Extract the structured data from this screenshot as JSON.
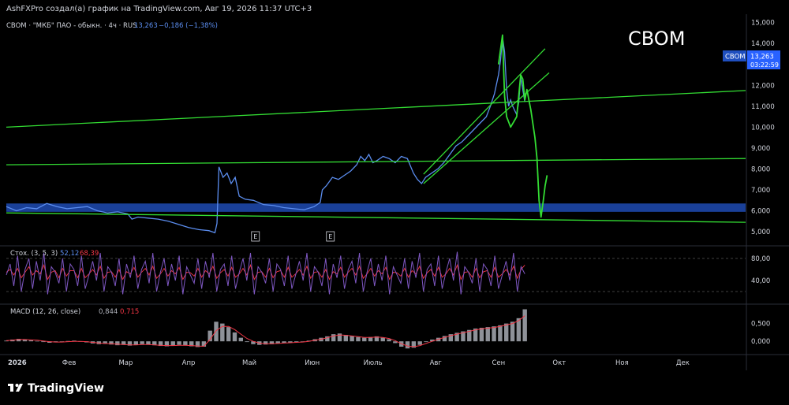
{
  "header": {
    "attribution": "AshFXPro создал(а) график на TradingView.com, Авг 19, 2026 11:37 UTC+3",
    "symbol_line": "CBOM · \"МКБ\" ПАО - обыкн. · 4ч · RUS",
    "last": "13,263",
    "change": "−0,186 (−1,38%)"
  },
  "watermark": "CBOM",
  "price_badge": {
    "ticker": "CBOM",
    "price": "13,263",
    "countdown": "03:22:59"
  },
  "footer": {
    "brand": "TradingView"
  },
  "colors": {
    "background": "#000000",
    "price_line": "#5b8def",
    "drawing_green": "#33dd33",
    "support_zone": "#1e4bb3",
    "stoch_k": "#7e57c2",
    "stoch_d": "#f23645",
    "macd_hist": "#b2b5be",
    "macd_signal": "#f23645",
    "text": "#d1d4dc",
    "blue_text": "#5b8def",
    "red_text": "#f23645"
  },
  "chart_data": [
    {
      "type": "line",
      "name": "price",
      "x_ticks": [
        "2026",
        "Фев",
        "Мар",
        "Апр",
        "Май",
        "Июн",
        "Июль",
        "Авг",
        "Сен",
        "Окт",
        "Ноя",
        "Дек"
      ],
      "y_ticks": [
        "5,000",
        "6,000",
        "7,000",
        "8,000",
        "9,000",
        "10,000",
        "11,000",
        "12,000",
        "13,000",
        "14,000",
        "15,000"
      ],
      "ylim": [
        4.4,
        15.4
      ],
      "xlim": [
        0,
        365
      ],
      "series": [
        {
          "values": [
            [
              0,
              6.2
            ],
            [
              5,
              6.0
            ],
            [
              10,
              6.15
            ],
            [
              15,
              6.1
            ],
            [
              20,
              6.35
            ],
            [
              25,
              6.2
            ],
            [
              30,
              6.1
            ],
            [
              35,
              6.15
            ],
            [
              40,
              6.2
            ],
            [
              45,
              6.0
            ],
            [
              50,
              5.9
            ],
            [
              55,
              5.95
            ],
            [
              60,
              5.85
            ],
            [
              62,
              5.6
            ],
            [
              65,
              5.7
            ],
            [
              70,
              5.65
            ],
            [
              75,
              5.6
            ],
            [
              80,
              5.5
            ],
            [
              85,
              5.35
            ],
            [
              90,
              5.2
            ],
            [
              95,
              5.1
            ],
            [
              100,
              5.05
            ],
            [
              103,
              4.95
            ],
            [
              104,
              5.4
            ],
            [
              105,
              8.1
            ],
            [
              107,
              7.6
            ],
            [
              109,
              7.8
            ],
            [
              111,
              7.3
            ],
            [
              113,
              7.6
            ],
            [
              115,
              6.7
            ],
            [
              118,
              6.55
            ],
            [
              122,
              6.5
            ],
            [
              127,
              6.3
            ],
            [
              132,
              6.25
            ],
            [
              137,
              6.15
            ],
            [
              142,
              6.1
            ],
            [
              147,
              6.05
            ],
            [
              152,
              6.2
            ],
            [
              155,
              6.4
            ],
            [
              156,
              7.0
            ],
            [
              158,
              7.2
            ],
            [
              161,
              7.6
            ],
            [
              164,
              7.5
            ],
            [
              167,
              7.7
            ],
            [
              170,
              7.9
            ],
            [
              173,
              8.2
            ],
            [
              175,
              8.6
            ],
            [
              177,
              8.4
            ],
            [
              179,
              8.7
            ],
            [
              181,
              8.3
            ],
            [
              183,
              8.4
            ],
            [
              186,
              8.6
            ],
            [
              189,
              8.5
            ],
            [
              192,
              8.3
            ],
            [
              195,
              8.6
            ],
            [
              198,
              8.5
            ],
            [
              201,
              7.8
            ],
            [
              203,
              7.5
            ],
            [
              205,
              7.3
            ],
            [
              207,
              7.6
            ],
            [
              210,
              7.8
            ],
            [
              213,
              8.0
            ],
            [
              216,
              8.3
            ],
            [
              219,
              8.7
            ],
            [
              222,
              9.1
            ],
            [
              225,
              9.3
            ],
            [
              228,
              9.6
            ],
            [
              231,
              9.9
            ],
            [
              234,
              10.2
            ],
            [
              237,
              10.5
            ],
            [
              239,
              11.0
            ],
            [
              241,
              11.6
            ],
            [
              243,
              12.5
            ],
            [
              244,
              13.2
            ],
            [
              245,
              14.3
            ],
            [
              246,
              13.6
            ],
            [
              247,
              11.8
            ],
            [
              248,
              11.0
            ],
            [
              249,
              11.3
            ],
            [
              250,
              11.0
            ],
            [
              251,
              10.8
            ],
            [
              252,
              10.6
            ],
            [
              253,
              11.2
            ],
            [
              254,
              12.4
            ],
            [
              255,
              11.8
            ],
            [
              256,
              11.2
            ]
          ]
        }
      ],
      "drawings": {
        "trendlines": [
          [
            [
              0,
              10.0
            ],
            [
              365,
              11.75
            ]
          ],
          [
            [
              0,
              8.2
            ],
            [
              365,
              8.5
            ]
          ],
          [
            [
              0,
              5.9
            ],
            [
              365,
              5.45
            ]
          ],
          [
            [
              206,
              7.3
            ],
            [
              268,
              12.6
            ]
          ],
          [
            [
              206,
              7.75
            ],
            [
              266,
              13.75
            ]
          ]
        ],
        "zone": [
          0,
          365,
          5.95,
          6.35
        ],
        "projection": [
          [
            243,
            13.0
          ],
          [
            245,
            14.4
          ],
          [
            246,
            11.5
          ],
          [
            247,
            10.5
          ],
          [
            249,
            10.0
          ],
          [
            252,
            10.5
          ],
          [
            254,
            12.5
          ],
          [
            255,
            12.3
          ],
          [
            256,
            11.3
          ],
          [
            257,
            11.8
          ],
          [
            259,
            10.8
          ],
          [
            261,
            9.5
          ],
          [
            262,
            8.5
          ],
          [
            263,
            6.5
          ],
          [
            264,
            5.7
          ],
          [
            265,
            6.4
          ],
          [
            266,
            7.2
          ],
          [
            267,
            7.7
          ]
        ],
        "earnings_markers": [
          {
            "x": 123,
            "label": "E"
          },
          {
            "x": 160,
            "label": "E"
          }
        ]
      }
    },
    {
      "type": "line",
      "name": "Стох. (3, 5, 3)",
      "legend": {
        "label": "Стох. (3, 5, 3)",
        "k": "52,12",
        "d": "68,39"
      },
      "y_ticks": [
        "40,00",
        "80,00"
      ],
      "ylim": [
        0,
        100
      ],
      "levels": [
        20,
        80
      ],
      "k_values": [
        50,
        70,
        30,
        85,
        20,
        60,
        80,
        25,
        75,
        40,
        90,
        15,
        65,
        55,
        35,
        80,
        20,
        70,
        60,
        30,
        85,
        25,
        50,
        75,
        40,
        90,
        20,
        65,
        55,
        30,
        80,
        15,
        70,
        45,
        85,
        25,
        60,
        75,
        35,
        90,
        20,
        55,
        80,
        30,
        70,
        40,
        85,
        15,
        65,
        50,
        35,
        80,
        25,
        75,
        45,
        90,
        20,
        60,
        70,
        30,
        85,
        25,
        55,
        80,
        40,
        90,
        15,
        65,
        55,
        35,
        80,
        20,
        70,
        60,
        30,
        85,
        25,
        50,
        75,
        40,
        90,
        20,
        65,
        55,
        30,
        80,
        15,
        70,
        45,
        85,
        25,
        60,
        75,
        35,
        90,
        20,
        55,
        80,
        30,
        70,
        40,
        85,
        15,
        65,
        50,
        35,
        80,
        25,
        75,
        45,
        90,
        20,
        60,
        70,
        30,
        85,
        25,
        55,
        80,
        40,
        92,
        15,
        65,
        55,
        35,
        80,
        20,
        70,
        60,
        30,
        85,
        25,
        50,
        75,
        40,
        90,
        20,
        65,
        52
      ],
      "d_values": [
        55,
        60,
        50,
        62,
        45,
        55,
        65,
        50,
        58,
        52,
        68,
        42,
        55,
        58,
        45,
        62,
        48,
        58,
        58,
        45,
        62,
        45,
        52,
        60,
        50,
        66,
        44,
        55,
        56,
        46,
        60,
        42,
        56,
        52,
        64,
        46,
        55,
        62,
        50,
        66,
        44,
        52,
        62,
        48,
        58,
        52,
        64,
        42,
        55,
        54,
        48,
        62,
        46,
        58,
        52,
        66,
        44,
        54,
        60,
        48,
        64,
        46,
        52,
        62,
        50,
        68,
        42,
        55,
        56,
        46,
        62,
        45,
        56,
        58,
        46,
        64,
        46,
        52,
        60,
        50,
        66,
        44,
        55,
        56,
        46,
        60,
        42,
        56,
        52,
        64,
        46,
        55,
        62,
        50,
        66,
        44,
        52,
        62,
        48,
        58,
        52,
        64,
        42,
        55,
        54,
        48,
        62,
        46,
        58,
        52,
        66,
        44,
        54,
        60,
        48,
        64,
        46,
        52,
        62,
        50,
        68,
        42,
        55,
        56,
        46,
        62,
        45,
        56,
        58,
        46,
        64,
        46,
        52,
        60,
        50,
        66,
        44,
        60,
        68
      ]
    },
    {
      "type": "bar",
      "name": "MACD (12, 26, close)",
      "legend": {
        "label": "MACD (12, 26, close)",
        "macd": "0,844",
        "signal": "0,715"
      },
      "y_ticks": [
        "0,000",
        "0,500"
      ],
      "ylim": [
        -0.35,
        1.0
      ],
      "hist": [
        0.02,
        0.05,
        0.07,
        0.06,
        0.03,
        0.01,
        -0.02,
        -0.04,
        -0.03,
        -0.01,
        0.01,
        0.02,
        0.0,
        -0.03,
        -0.06,
        -0.08,
        -0.07,
        -0.09,
        -0.11,
        -0.1,
        -0.12,
        -0.1,
        -0.08,
        -0.09,
        -0.11,
        -0.13,
        -0.14,
        -0.12,
        -0.1,
        -0.12,
        -0.14,
        -0.16,
        -0.15,
        0.3,
        0.55,
        0.5,
        0.4,
        0.25,
        0.1,
        -0.02,
        -0.08,
        -0.1,
        -0.09,
        -0.08,
        -0.06,
        -0.05,
        -0.04,
        -0.02,
        -0.01,
        0.02,
        0.06,
        0.1,
        0.14,
        0.2,
        0.22,
        0.18,
        0.15,
        0.12,
        0.1,
        0.12,
        0.14,
        0.1,
        0.06,
        -0.05,
        -0.15,
        -0.2,
        -0.18,
        -0.1,
        -0.02,
        0.05,
        0.1,
        0.15,
        0.2,
        0.24,
        0.28,
        0.32,
        0.36,
        0.38,
        0.4,
        0.42,
        0.45,
        0.5,
        0.55,
        0.65,
        0.9
      ],
      "signal": [
        0.02,
        0.03,
        0.05,
        0.05,
        0.04,
        0.03,
        0.01,
        -0.01,
        -0.02,
        -0.02,
        -0.01,
        0.0,
        0.0,
        -0.01,
        -0.03,
        -0.05,
        -0.06,
        -0.07,
        -0.08,
        -0.09,
        -0.1,
        -0.1,
        -0.09,
        -0.09,
        -0.1,
        -0.11,
        -0.12,
        -0.12,
        -0.11,
        -0.11,
        -0.12,
        -0.13,
        -0.14,
        0.05,
        0.3,
        0.42,
        0.42,
        0.33,
        0.2,
        0.08,
        0.0,
        -0.05,
        -0.07,
        -0.07,
        -0.06,
        -0.05,
        -0.04,
        -0.03,
        -0.02,
        0.0,
        0.03,
        0.06,
        0.1,
        0.15,
        0.18,
        0.17,
        0.15,
        0.13,
        0.11,
        0.11,
        0.12,
        0.11,
        0.08,
        0.02,
        -0.07,
        -0.13,
        -0.15,
        -0.12,
        -0.06,
        0.0,
        0.06,
        0.11,
        0.16,
        0.2,
        0.24,
        0.28,
        0.32,
        0.35,
        0.37,
        0.39,
        0.42,
        0.46,
        0.5,
        0.58,
        0.72
      ]
    }
  ]
}
